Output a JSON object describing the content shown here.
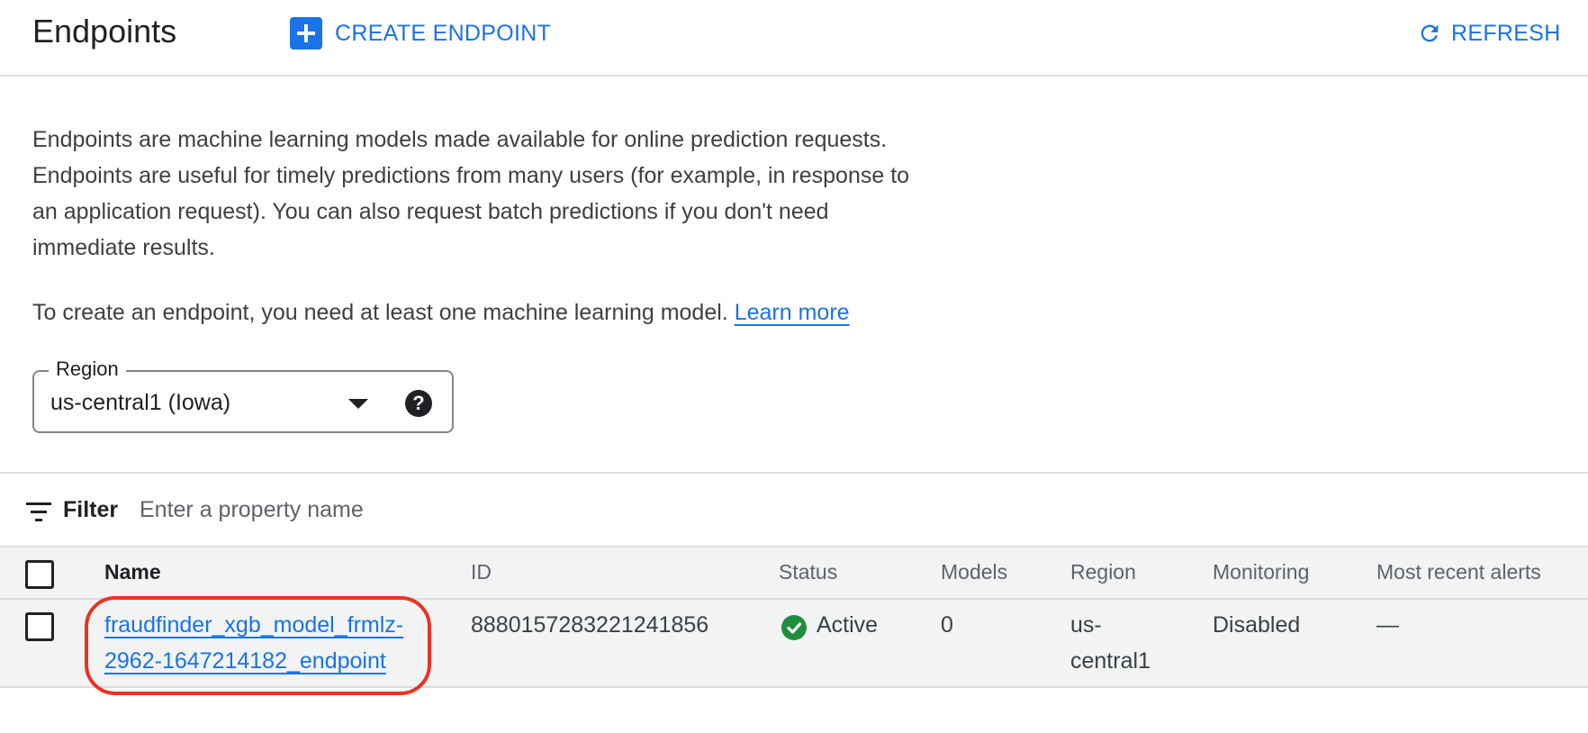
{
  "header": {
    "title": "Endpoints",
    "create_label": "CREATE ENDPOINT",
    "refresh_label": "REFRESH"
  },
  "description": {
    "line1": "Endpoints are machine learning models made available for online prediction requests.",
    "line2": "Endpoints are useful for timely predictions from many users (for example, in response to",
    "line3": "an application request). You can also request batch predictions if you don't need",
    "line4": "immediate results."
  },
  "create_note": {
    "text": "To create an endpoint, you need at least one machine learning model.",
    "link": "Learn more"
  },
  "region_select": {
    "label": "Region",
    "value": "us-central1 (Iowa)",
    "help": "?"
  },
  "filter": {
    "label": "Filter",
    "placeholder": "Enter a property name"
  },
  "table": {
    "columns": [
      "Name",
      "ID",
      "Status",
      "Models",
      "Region",
      "Monitoring",
      "Most recent alerts"
    ],
    "rows": [
      {
        "name_line1": "fraudfinder_xgb_model_frmlz-",
        "name_line2": "2962-1647214182_endpoint",
        "id": "8880157283221241856",
        "status": "Active",
        "models": "0",
        "region_line1": "us-",
        "region_line2": "central1",
        "monitoring": "Disabled",
        "alerts": "—"
      }
    ]
  },
  "colors": {
    "accent": "#1a73e8",
    "status_active": "#1e8e3e",
    "highlight": "#ea3323"
  },
  "icons": [
    "plus-icon",
    "refresh-icon",
    "caret-down-icon",
    "help-icon",
    "filter-icon",
    "check-circle-icon"
  ]
}
